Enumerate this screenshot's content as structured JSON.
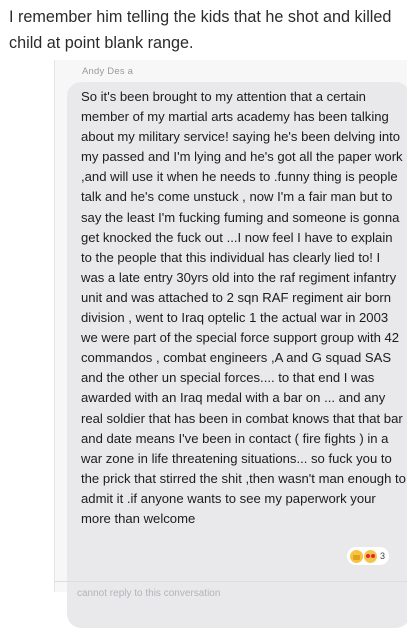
{
  "caption": "I remember him telling the kids that he shot and killed child at point blank range.",
  "sender_name": "Andy Des a",
  "message": "So it's been brought to my attention that a certain member of my martial arts academy has been talking about my military service! saying he's been delving into my passed and I'm lying and he's got all the paper work ,and will use it when he needs to .funny thing is people talk and he's come unstuck , now I'm a fair man but to say the least I'm fucking fuming and someone is gonna get knocked the fuck out ...I now feel I have to explain to the people that this individual has clearly lied to! I was a late entry 30yrs old into the raf regiment infantry unit and was attached to 2 sqn RAF regiment air born division , went to Iraq optelic 1 the actual war in 2003 we were part of the special force support group with 42 commandos , combat engineers ,A and G squad SAS and the other un special forces.... to that end I was awarded with an Iraq medal with a bar on ... and any real soldier that has been in combat knows that that bar and date means I've been in contact ( fire fights ) in a war zone in life threatening situations... so fuck you to the prick that stirred the shit ,then wasn't man enough to admit it .if anyone wants to see my paperwork your more than welcome",
  "reactions": {
    "icons": [
      "thumbs-up",
      "love-face"
    ],
    "count": "3"
  },
  "footer_note": "cannot reply to this conversation"
}
